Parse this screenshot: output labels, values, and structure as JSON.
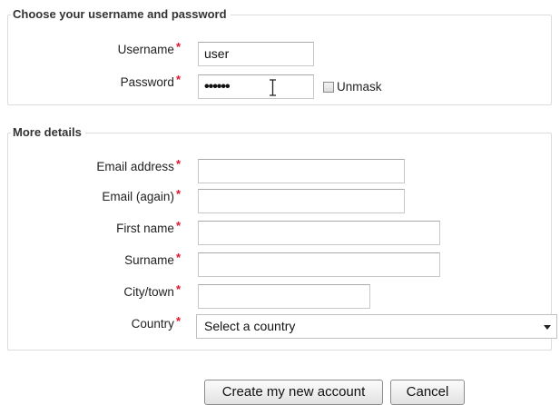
{
  "section_account": {
    "legend": "Choose your username and password",
    "username_label": "Username",
    "username_value": "user",
    "password_label": "Password",
    "password_value": "••••••",
    "unmask_label": "Unmask",
    "unmask_checked": false
  },
  "section_details": {
    "legend": "More details",
    "email_label": "Email address",
    "email_value": "",
    "email_again_label": "Email (again)",
    "email_again_value": "",
    "firstname_label": "First name",
    "firstname_value": "",
    "surname_label": "Surname",
    "surname_value": "",
    "city_label": "City/town",
    "city_value": "",
    "country_label": "Country",
    "country_selected": "Select a country"
  },
  "required_marker": "*",
  "buttons": {
    "create_label": "Create my new account",
    "cancel_label": "Cancel"
  },
  "colors": {
    "required": "#e0132a",
    "border": "#dcdcdc"
  }
}
